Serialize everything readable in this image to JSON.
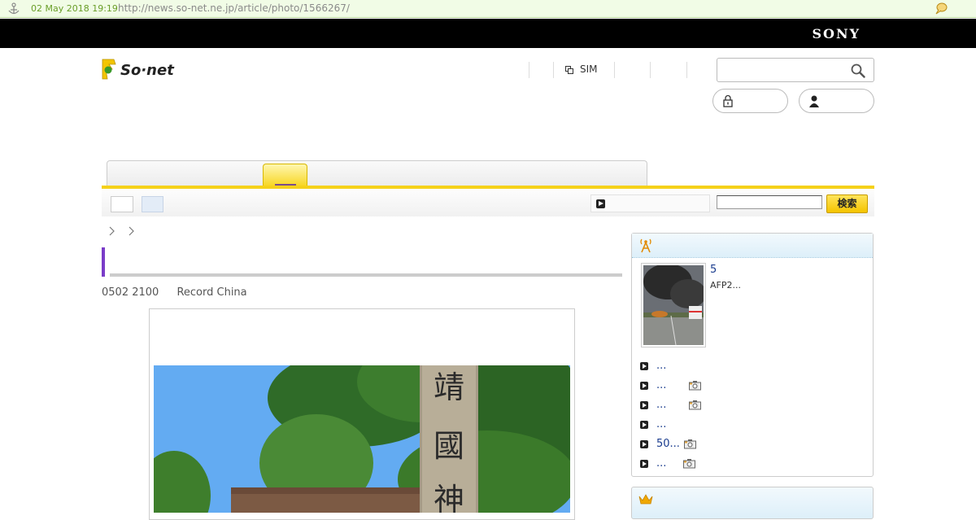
{
  "archive_bar": {
    "date": "02 May 2018 19:19",
    "url": "http://news.so-net.ne.jp/article/photo/1566267/",
    "accent": "#6a9e29"
  },
  "brand_bar": {
    "brand": "SONY"
  },
  "site": {
    "logo_text": "So·net",
    "accent": "#f5d11a"
  },
  "topnav": {
    "sim_label": "SIM"
  },
  "search": {
    "placeholder": ""
  },
  "subnav": {
    "search_button": "検索",
    "keyword_value": ""
  },
  "article": {
    "date": "0502 2100",
    "source": "Record China",
    "title_accent": "#7a3cc8"
  },
  "sidebar": {
    "icon": "antenna-icon",
    "feature": {
      "number": "5",
      "desc": "AFP2..."
    },
    "items": [
      {
        "text": "...",
        "has_photo": false
      },
      {
        "text": "...",
        "has_photo": true
      },
      {
        "text": "...",
        "has_photo": true
      },
      {
        "text": "...",
        "has_photo": false
      },
      {
        "text": "50...",
        "has_photo": true
      },
      {
        "text": "...",
        "has_photo": true
      }
    ]
  },
  "ranking": {
    "icon": "crown-icon"
  }
}
